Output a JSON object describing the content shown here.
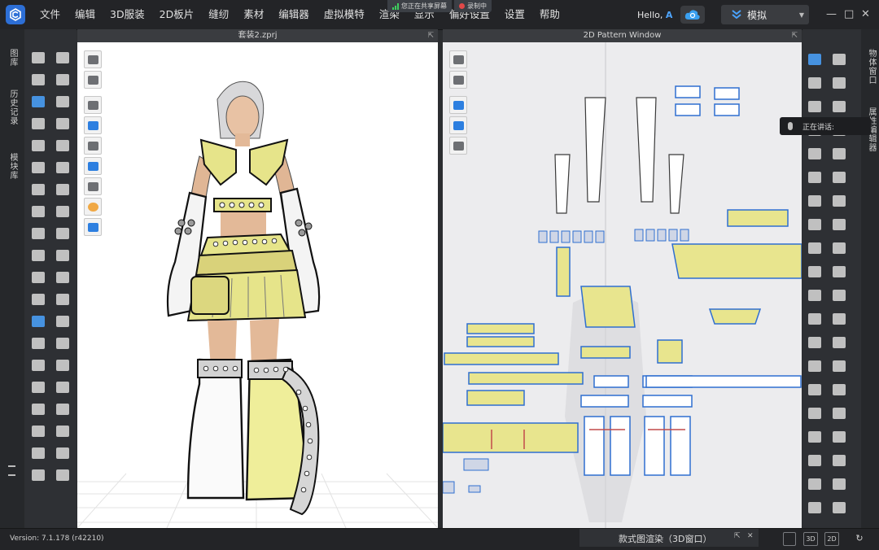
{
  "menu": [
    "文件",
    "编辑",
    "3D服装",
    "2D板片",
    "缝纫",
    "素材",
    "编辑器",
    "虚拟模特",
    "渲染",
    "显示",
    "偏好设置",
    "设置",
    "帮助"
  ],
  "share": {
    "sharing": "您正在共享屏幕",
    "recording": "录制中"
  },
  "user": {
    "hello": "Hello,",
    "initial": "A"
  },
  "mode": {
    "label": "模拟"
  },
  "window_controls": [
    "—",
    "□",
    "✕"
  ],
  "left_tabs": [
    "图库",
    "历史记录",
    "模块库"
  ],
  "panes": {
    "view3d_title": "套装2.zprj",
    "view2d_title": "2D Pattern Window"
  },
  "right_tabs": [
    "物体窗口",
    "属性编辑器"
  ],
  "speaking": "正在讲话:",
  "status": {
    "version": "Version: 7.1.178 (r42210)",
    "render_tab": "款式图渲染（3D窗口）",
    "buttons": [
      "3D",
      "2D"
    ]
  },
  "colors": {
    "accent": "#2d6fd6",
    "share_border": "#1fd15f",
    "garment": "#e6e48a",
    "pattern_fill": "#e8e58e",
    "pattern_stroke": "#2f6fd0"
  },
  "icons": [
    "app-logo-icon",
    "cloud-sync-icon",
    "simulate-icon",
    "expand-icon",
    "mic-icon"
  ]
}
